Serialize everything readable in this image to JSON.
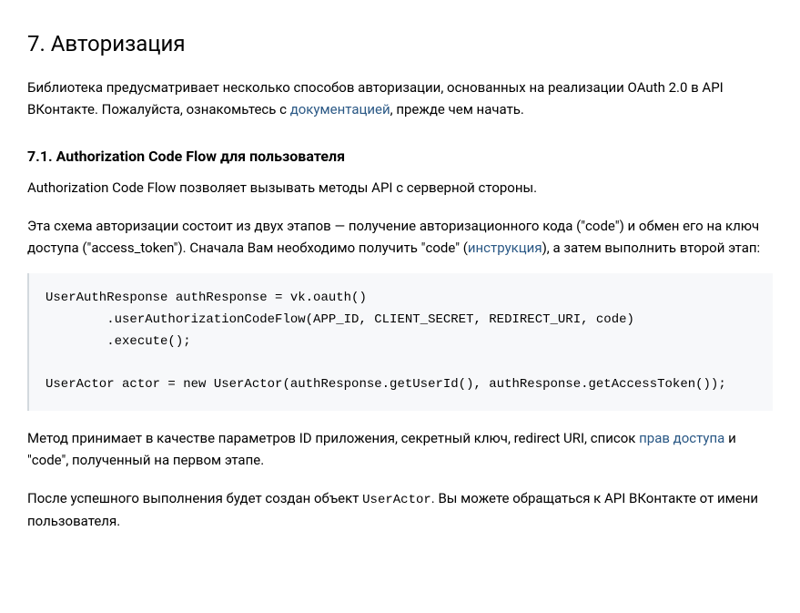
{
  "h2": "7. Авторизация",
  "intro": {
    "part1": "Библиотека предусматривает несколько способов авторизации, основанных на реализации OAuth 2.0 в API ВКонтакте. Пожалуйста, ознакомьтесь с ",
    "link": "документацией",
    "part2": ", прежде чем начать."
  },
  "h3": "7.1. Authorization Code Flow для пользователя",
  "p1": "Authorization Code Flow позволяет вызывать методы API с серверной стороны.",
  "p2": {
    "part1": "Эта схема авторизации состоит из двух этапов — получение авторизационного кода (\"code\") и обмен его на ключ доступа (\"access_token\"). Сначала Вам необходимо получить \"code\" (",
    "link": "инструкция",
    "part2": "), а затем выполнить второй этап:"
  },
  "code": "UserAuthResponse authResponse = vk.oauth()\n        .userAuthorizationCodeFlow(APP_ID, CLIENT_SECRET, REDIRECT_URI, code)\n        .execute();\n\nUserActor actor = new UserActor(authResponse.getUserId(), authResponse.getAccessToken());",
  "p3": {
    "part1": "Метод принимает в качестве параметров ID приложения, секретный ключ, redirect URI, список ",
    "link": "прав доступа",
    "part2": " и \"code\", полученный на первом этапе."
  },
  "p4": {
    "part1": "После успешного выполнения будет создан объект ",
    "code": "UserActor",
    "part2": ". Вы можете обращаться к API ВКонтакте от имени пользователя."
  }
}
